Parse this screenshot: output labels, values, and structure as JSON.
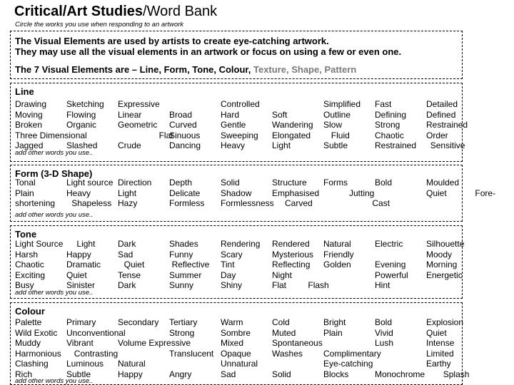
{
  "header": {
    "title_bold": "Critical/Art Studies",
    "title_rest": "/Word Bank",
    "subtitle": "Circle the works you use when responding to an artwork"
  },
  "intro": {
    "line1": "The Visual Elements are used by artists to create eye-catching artwork.",
    "line2": "They may use all the visual elements in an artwork or focus on using a few or even one.",
    "elements_prefix": "The 7 Visual Elements are – Line, Form, Tone, Colour, ",
    "elements_grey": "Texture, Shape, Pattern",
    "grey_color": "#7a7a7a"
  },
  "add_words_label": "add other words you use..",
  "sections": [
    {
      "title": "Line",
      "words": [
        {
          "text": "Drawing",
          "col": 0,
          "row": 0
        },
        {
          "text": "Sketching",
          "col": 1,
          "row": 0
        },
        {
          "text": "Expressive",
          "col": 2,
          "row": 0
        },
        {
          "text": "Controlled",
          "col": 4,
          "row": 0
        },
        {
          "text": "Simplified",
          "col": 6,
          "row": 0
        },
        {
          "text": "Fast",
          "col": 7,
          "row": 0
        },
        {
          "text": "Detailed",
          "col": 8,
          "row": 0
        },
        {
          "text": "Moving",
          "col": 0,
          "row": 1
        },
        {
          "text": "Flowing",
          "col": 1,
          "row": 1
        },
        {
          "text": "Linear",
          "col": 2,
          "row": 1
        },
        {
          "text": "Broad",
          "col": 3,
          "row": 1
        },
        {
          "text": "Hard",
          "col": 4,
          "row": 1
        },
        {
          "text": "Soft",
          "col": 5,
          "row": 1
        },
        {
          "text": "Outline",
          "col": 6,
          "row": 1
        },
        {
          "text": "Defining",
          "col": 7,
          "row": 1
        },
        {
          "text": "Defined",
          "col": 8,
          "row": 1
        },
        {
          "text": "Broken",
          "col": 0,
          "row": 2
        },
        {
          "text": "Organic",
          "col": 1,
          "row": 2
        },
        {
          "text": "Geometric",
          "col": 2,
          "row": 2
        },
        {
          "text": "Curved",
          "col": 3,
          "row": 2
        },
        {
          "text": "Gentle",
          "col": 4,
          "row": 2
        },
        {
          "text": "Wandering",
          "col": 5,
          "row": 2
        },
        {
          "text": "Slow",
          "col": 6,
          "row": 2
        },
        {
          "text": "Strong",
          "col": 7,
          "row": 2
        },
        {
          "text": "Restrained",
          "col": 8,
          "row": 2
        },
        {
          "text": "Three Dimensional",
          "col": 0,
          "row": 3
        },
        {
          "text": "Flat",
          "col": 2.8,
          "row": 3
        },
        {
          "text": "Sinuous",
          "col": 3,
          "row": 3
        },
        {
          "text": "Sweeping",
          "col": 4,
          "row": 3
        },
        {
          "text": "Elongated",
          "col": 5,
          "row": 3
        },
        {
          "text": "Fluid",
          "col": 6.15,
          "row": 3
        },
        {
          "text": "Chaotic",
          "col": 7,
          "row": 3
        },
        {
          "text": "Order",
          "col": 8,
          "row": 3
        },
        {
          "text": "Jagged",
          "col": 0,
          "row": 4
        },
        {
          "text": "Slashed",
          "col": 1,
          "row": 4
        },
        {
          "text": "Crude",
          "col": 2,
          "row": 4
        },
        {
          "text": "Dancing",
          "col": 3,
          "row": 4
        },
        {
          "text": "Heavy",
          "col": 4,
          "row": 4
        },
        {
          "text": "Light",
          "col": 5,
          "row": 4
        },
        {
          "text": "Subtle",
          "col": 6,
          "row": 4
        },
        {
          "text": "Restrained",
          "col": 7,
          "row": 4
        },
        {
          "text": "Sensitive",
          "col": 8.08,
          "row": 4
        }
      ]
    },
    {
      "title": "Form (3-D Shape)",
      "words": [
        {
          "text": "Tonal",
          "col": 0,
          "row": 0
        },
        {
          "text": "Light source",
          "col": 1,
          "row": 0
        },
        {
          "text": "Direction",
          "col": 2,
          "row": 0
        },
        {
          "text": "Depth",
          "col": 3,
          "row": 0
        },
        {
          "text": "Solid",
          "col": 4,
          "row": 0
        },
        {
          "text": "Structure",
          "col": 5,
          "row": 0
        },
        {
          "text": "Forms",
          "col": 6,
          "row": 0
        },
        {
          "text": "Bold",
          "col": 7,
          "row": 0
        },
        {
          "text": "Moulded",
          "col": 8,
          "row": 0
        },
        {
          "text": "Plain",
          "col": 0,
          "row": 1
        },
        {
          "text": "Heavy",
          "col": 1,
          "row": 1
        },
        {
          "text": "Light",
          "col": 2,
          "row": 1
        },
        {
          "text": "Delicate",
          "col": 3,
          "row": 1
        },
        {
          "text": "Shadow",
          "col": 4,
          "row": 1
        },
        {
          "text": "Emphasised",
          "col": 5,
          "row": 1
        },
        {
          "text": "Jutting",
          "col": 6.5,
          "row": 1
        },
        {
          "text": "Quiet",
          "col": 8,
          "row": 1
        },
        {
          "text": "Fore-",
          "col": 8.95,
          "row": 1
        },
        {
          "text": "shortening",
          "col": 0,
          "row": 2
        },
        {
          "text": "Shapeless",
          "col": 1.1,
          "row": 2
        },
        {
          "text": "Hazy",
          "col": 2,
          "row": 2
        },
        {
          "text": "Formless",
          "col": 3,
          "row": 2
        },
        {
          "text": "Formlessness",
          "col": 4,
          "row": 2
        },
        {
          "text": "Carved",
          "col": 5.25,
          "row": 2
        },
        {
          "text": "Cast",
          "col": 6.95,
          "row": 2
        }
      ]
    },
    {
      "title": "Tone",
      "words": [
        {
          "text": "Light Source",
          "col": 0,
          "row": 0
        },
        {
          "text": "Light",
          "col": 1.2,
          "row": 0
        },
        {
          "text": "Dark",
          "col": 2,
          "row": 0
        },
        {
          "text": "Shades",
          "col": 3,
          "row": 0
        },
        {
          "text": "Rendering",
          "col": 4,
          "row": 0
        },
        {
          "text": "Rendered",
          "col": 5,
          "row": 0
        },
        {
          "text": "Natural",
          "col": 6,
          "row": 0
        },
        {
          "text": "Electric",
          "col": 7,
          "row": 0
        },
        {
          "text": "Silhouette",
          "col": 8,
          "row": 0
        },
        {
          "text": "Harsh",
          "col": 0,
          "row": 1
        },
        {
          "text": "Happy",
          "col": 1,
          "row": 1
        },
        {
          "text": "Sad",
          "col": 2,
          "row": 1
        },
        {
          "text": "Funny",
          "col": 3,
          "row": 1
        },
        {
          "text": "Scary",
          "col": 4,
          "row": 1
        },
        {
          "text": "Mysterious",
          "col": 5,
          "row": 1
        },
        {
          "text": "Friendly",
          "col": 6,
          "row": 1
        },
        {
          "text": "Moody",
          "col": 8,
          "row": 1
        },
        {
          "text": "Chaotic",
          "col": 0,
          "row": 2
        },
        {
          "text": "Dramatic",
          "col": 1,
          "row": 2
        },
        {
          "text": "Quiet",
          "col": 2.12,
          "row": 2
        },
        {
          "text": "Reflective",
          "col": 3.05,
          "row": 2
        },
        {
          "text": "Tint",
          "col": 4,
          "row": 2
        },
        {
          "text": "Reflecting",
          "col": 5,
          "row": 2
        },
        {
          "text": "Golden",
          "col": 6,
          "row": 2
        },
        {
          "text": "Evening",
          "col": 7,
          "row": 2
        },
        {
          "text": "Morning",
          "col": 8,
          "row": 2
        },
        {
          "text": "Exciting",
          "col": 0,
          "row": 3
        },
        {
          "text": "Quiet",
          "col": 1,
          "row": 3
        },
        {
          "text": "Tense",
          "col": 2,
          "row": 3
        },
        {
          "text": "Summer",
          "col": 3,
          "row": 3
        },
        {
          "text": "Day",
          "col": 4,
          "row": 3
        },
        {
          "text": "Night",
          "col": 5,
          "row": 3
        },
        {
          "text": "Powerful",
          "col": 7,
          "row": 3
        },
        {
          "text": "Energetic",
          "col": 8,
          "row": 3
        },
        {
          "text": "Busy",
          "col": 0,
          "row": 4
        },
        {
          "text": "Sinister",
          "col": 1,
          "row": 4
        },
        {
          "text": "Dark",
          "col": 2,
          "row": 4
        },
        {
          "text": "Sunny",
          "col": 3,
          "row": 4
        },
        {
          "text": "Shiny",
          "col": 4,
          "row": 4
        },
        {
          "text": "Flat",
          "col": 5,
          "row": 4
        },
        {
          "text": "Flash",
          "col": 5.7,
          "row": 4
        },
        {
          "text": "Hint",
          "col": 7,
          "row": 4
        }
      ]
    },
    {
      "title": "Colour",
      "words": [
        {
          "text": "Palette",
          "col": 0,
          "row": 0
        },
        {
          "text": "Primary",
          "col": 1,
          "row": 0
        },
        {
          "text": "Secondary",
          "col": 2,
          "row": 0
        },
        {
          "text": "Tertiary",
          "col": 3,
          "row": 0
        },
        {
          "text": "Warm",
          "col": 4,
          "row": 0
        },
        {
          "text": "Cold",
          "col": 5,
          "row": 0
        },
        {
          "text": "Bright",
          "col": 6,
          "row": 0
        },
        {
          "text": "Bold",
          "col": 7,
          "row": 0
        },
        {
          "text": "Explosion",
          "col": 8,
          "row": 0
        },
        {
          "text": "Wild Exotic",
          "col": 0,
          "row": 1
        },
        {
          "text": "Unconventional",
          "col": 1,
          "row": 1
        },
        {
          "text": "Strong",
          "col": 3,
          "row": 1
        },
        {
          "text": "Sombre",
          "col": 4,
          "row": 1
        },
        {
          "text": "Muted",
          "col": 5,
          "row": 1
        },
        {
          "text": "Plain",
          "col": 6,
          "row": 1
        },
        {
          "text": "Vivid",
          "col": 7,
          "row": 1
        },
        {
          "text": "Quiet",
          "col": 8,
          "row": 1
        },
        {
          "text": "Muddy",
          "col": 0,
          "row": 2
        },
        {
          "text": "Vibrant",
          "col": 1,
          "row": 2
        },
        {
          "text": "Volume Expressive",
          "col": 2,
          "row": 2
        },
        {
          "text": "Mixed",
          "col": 4,
          "row": 2
        },
        {
          "text": "Spontaneous",
          "col": 5,
          "row": 2
        },
        {
          "text": "Lush",
          "col": 7,
          "row": 2
        },
        {
          "text": "Intense",
          "col": 8,
          "row": 2
        },
        {
          "text": "Harmonious",
          "col": 0,
          "row": 3
        },
        {
          "text": "Contrasting",
          "col": 1.15,
          "row": 3
        },
        {
          "text": "Translucent",
          "col": 3,
          "row": 3
        },
        {
          "text": "Opaque",
          "col": 4,
          "row": 3
        },
        {
          "text": "Washes",
          "col": 5,
          "row": 3
        },
        {
          "text": "Complimentary",
          "col": 6,
          "row": 3
        },
        {
          "text": "Limited",
          "col": 8,
          "row": 3
        },
        {
          "text": "Clashing",
          "col": 0,
          "row": 4
        },
        {
          "text": "Luminous",
          "col": 1,
          "row": 4
        },
        {
          "text": "Natural",
          "col": 2,
          "row": 4
        },
        {
          "text": "Unnatural",
          "col": 4,
          "row": 4
        },
        {
          "text": "Eye-catching",
          "col": 6,
          "row": 4
        },
        {
          "text": "Earthy",
          "col": 8,
          "row": 4
        },
        {
          "text": "Rich",
          "col": 0,
          "row": 5
        },
        {
          "text": "Subtle",
          "col": 1,
          "row": 5
        },
        {
          "text": "Happy",
          "col": 2,
          "row": 5
        },
        {
          "text": "Angry",
          "col": 3,
          "row": 5
        },
        {
          "text": "Sad",
          "col": 4,
          "row": 5
        },
        {
          "text": "Solid",
          "col": 5,
          "row": 5
        },
        {
          "text": "Blocks",
          "col": 6,
          "row": 5
        },
        {
          "text": "Monochrome",
          "col": 7,
          "row": 5
        },
        {
          "text": "Splash",
          "col": 8.33,
          "row": 5
        }
      ]
    }
  ]
}
